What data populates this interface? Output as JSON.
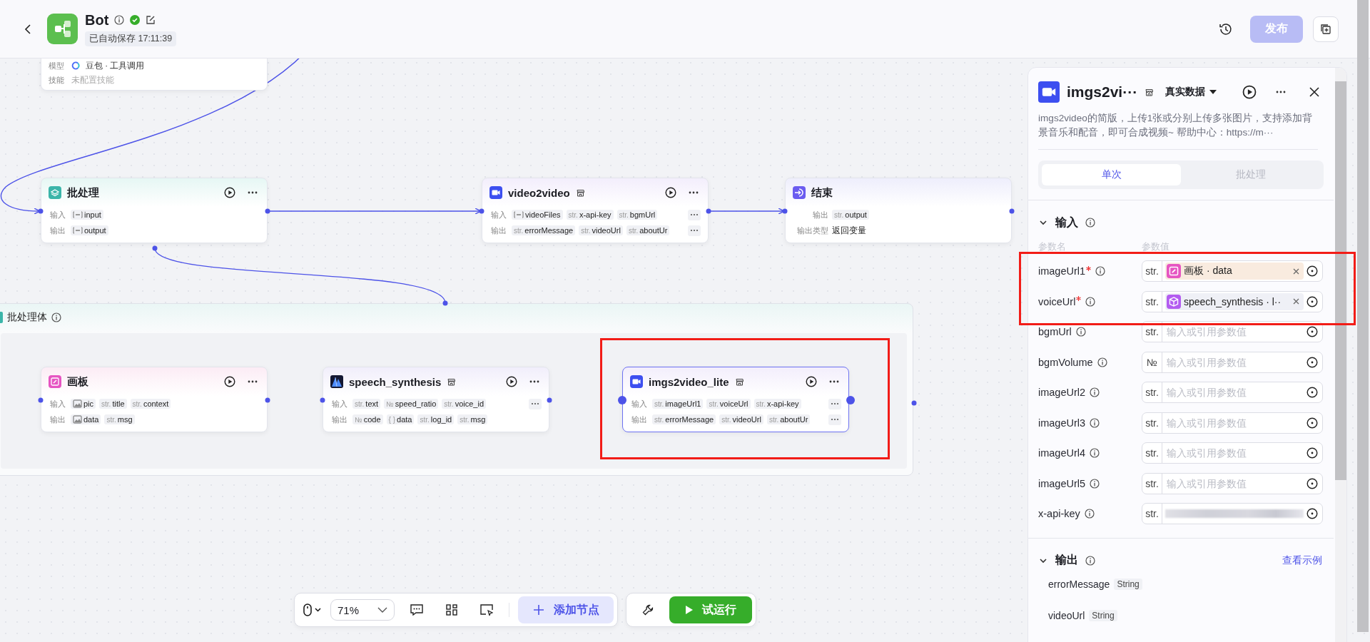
{
  "header": {
    "title": "Bot",
    "autosave": "已自动保存 17:11:39",
    "publish": "发布"
  },
  "canvas": {
    "agent_node": {
      "rows": [
        {
          "label": "模型",
          "value": "豆包 · 工具调用"
        },
        {
          "label": "技能",
          "value": "未配置技能"
        }
      ]
    },
    "nodes": [
      {
        "kind": "batch",
        "title": "批处理",
        "store": false,
        "actions": true,
        "selected": false,
        "rows": [
          {
            "label": "输入",
            "more": false,
            "tags": [
              {
                "kind": "array",
                "name": "input"
              }
            ]
          },
          {
            "label": "输出",
            "more": false,
            "tags": [
              {
                "kind": "array",
                "name": "output"
              }
            ]
          }
        ]
      },
      {
        "kind": "video",
        "title": "video2video",
        "store": true,
        "actions": true,
        "selected": false,
        "rows": [
          {
            "label": "输入",
            "more": true,
            "tags": [
              {
                "kind": "array",
                "name": "videoFiles"
              },
              {
                "kind": "text",
                "prefix": "str.",
                "name": "x-api-key"
              },
              {
                "kind": "text",
                "prefix": "str.",
                "name": "bgmUrl"
              }
            ]
          },
          {
            "label": "输出",
            "more": true,
            "tags": [
              {
                "kind": "text",
                "prefix": "str.",
                "name": "errorMessage"
              },
              {
                "kind": "text",
                "prefix": "str.",
                "name": "videoUrl"
              },
              {
                "kind": "text",
                "prefix": "str.",
                "name": "aboutUr"
              }
            ]
          }
        ]
      },
      {
        "kind": "end",
        "title": "结束",
        "store": false,
        "actions": false,
        "selected": false,
        "rows": [
          {
            "label": "输出",
            "more": false,
            "tags": [
              {
                "kind": "text",
                "prefix": "str.",
                "name": "output"
              }
            ]
          },
          {
            "label": "输出类型",
            "more": false,
            "value": "返回变量"
          }
        ]
      },
      {
        "kind": "board",
        "title": "画板",
        "store": false,
        "actions": true,
        "selected": false,
        "rows": [
          {
            "label": "输入",
            "more": false,
            "tags": [
              {
                "kind": "image",
                "name": "pic"
              },
              {
                "kind": "text",
                "prefix": "str.",
                "name": "title"
              },
              {
                "kind": "text",
                "prefix": "str.",
                "name": "context"
              }
            ]
          },
          {
            "label": "输出",
            "more": false,
            "tags": [
              {
                "kind": "image",
                "name": "data"
              },
              {
                "kind": "text",
                "prefix": "str.",
                "name": "msg"
              }
            ]
          }
        ]
      },
      {
        "kind": "speech",
        "title": "speech_synthesis",
        "store": true,
        "actions": true,
        "selected": false,
        "rows": [
          {
            "label": "输入",
            "more": true,
            "tags": [
              {
                "kind": "text",
                "prefix": "str.",
                "name": "text"
              },
              {
                "kind": "text",
                "prefix": "№",
                "name": "speed_ratio"
              },
              {
                "kind": "text",
                "prefix": "str.",
                "name": "voice_id"
              }
            ]
          },
          {
            "label": "输出",
            "more": false,
            "tags": [
              {
                "kind": "text",
                "prefix": "№",
                "name": "code"
              },
              {
                "kind": "text",
                "prefix": "{ }",
                "name": "data"
              },
              {
                "kind": "text",
                "prefix": "str.",
                "name": "log_id"
              },
              {
                "kind": "text",
                "prefix": "str.",
                "name": "msg"
              }
            ]
          }
        ]
      },
      {
        "kind": "video",
        "title": "imgs2video_lite",
        "store": true,
        "actions": true,
        "selected": true,
        "rows": [
          {
            "label": "输入",
            "more": true,
            "tags": [
              {
                "kind": "text",
                "prefix": "str.",
                "name": "imageUrl1"
              },
              {
                "kind": "text",
                "prefix": "str.",
                "name": "voiceUrl"
              },
              {
                "kind": "text",
                "prefix": "str.",
                "name": "x-api-key"
              }
            ]
          },
          {
            "label": "输出",
            "more": true,
            "tags": [
              {
                "kind": "text",
                "prefix": "str.",
                "name": "errorMessage"
              },
              {
                "kind": "text",
                "prefix": "str.",
                "name": "videoUrl"
              },
              {
                "kind": "text",
                "prefix": "str.",
                "name": "aboutUr"
              }
            ]
          }
        ]
      }
    ],
    "loop_body": {
      "title": "批处理体"
    }
  },
  "panel": {
    "title": "imgs2vi···",
    "data_mode": "真实数据",
    "description": "imgs2video的简版，上传1张或分别上传多张图片，支持添加背景音乐和配音，即可合成视频~ 帮助中心：https://m···",
    "tabs": [
      {
        "label": "单次",
        "selected": true
      },
      {
        "label": "批处理",
        "selected": false
      }
    ],
    "inputs": {
      "title": "输入",
      "expanded": true,
      "col_name": "参数名",
      "col_value": "参数值",
      "params": [
        {
          "name": "imageUrl1",
          "required": true,
          "type": "str.",
          "kind": "ref",
          "ref": {
            "kind": "board",
            "text": "画板 · data"
          }
        },
        {
          "name": "voiceUrl",
          "required": true,
          "type": "str.",
          "kind": "ref",
          "ref": {
            "kind": "plugin",
            "text": "speech_synthesis · l··"
          }
        },
        {
          "name": "bgmUrl",
          "required": false,
          "type": "str.",
          "kind": "input",
          "placeholder": "输入或引用参数值"
        },
        {
          "name": "bgmVolume",
          "required": false,
          "type": "№",
          "kind": "input",
          "placeholder": "输入或引用参数值"
        },
        {
          "name": "imageUrl2",
          "required": false,
          "type": "str.",
          "kind": "input",
          "placeholder": "输入或引用参数值"
        },
        {
          "name": "imageUrl3",
          "required": false,
          "type": "str.",
          "kind": "input",
          "placeholder": "输入或引用参数值"
        },
        {
          "name": "imageUrl4",
          "required": false,
          "type": "str.",
          "kind": "input",
          "placeholder": "输入或引用参数值"
        },
        {
          "name": "imageUrl5",
          "required": false,
          "type": "str.",
          "kind": "input",
          "placeholder": "输入或引用参数值"
        },
        {
          "name": "x-api-key",
          "required": false,
          "type": "str.",
          "kind": "masked"
        }
      ]
    },
    "outputs": {
      "title": "输出",
      "expanded": true,
      "example_link": "查看示例",
      "items": [
        {
          "name": "errorMessage",
          "type": "String"
        },
        {
          "name": "videoUrl",
          "type": "String"
        }
      ]
    }
  },
  "toolbar": {
    "zoom": "71%",
    "add_node": "添加节点",
    "test_run": "试运行"
  }
}
